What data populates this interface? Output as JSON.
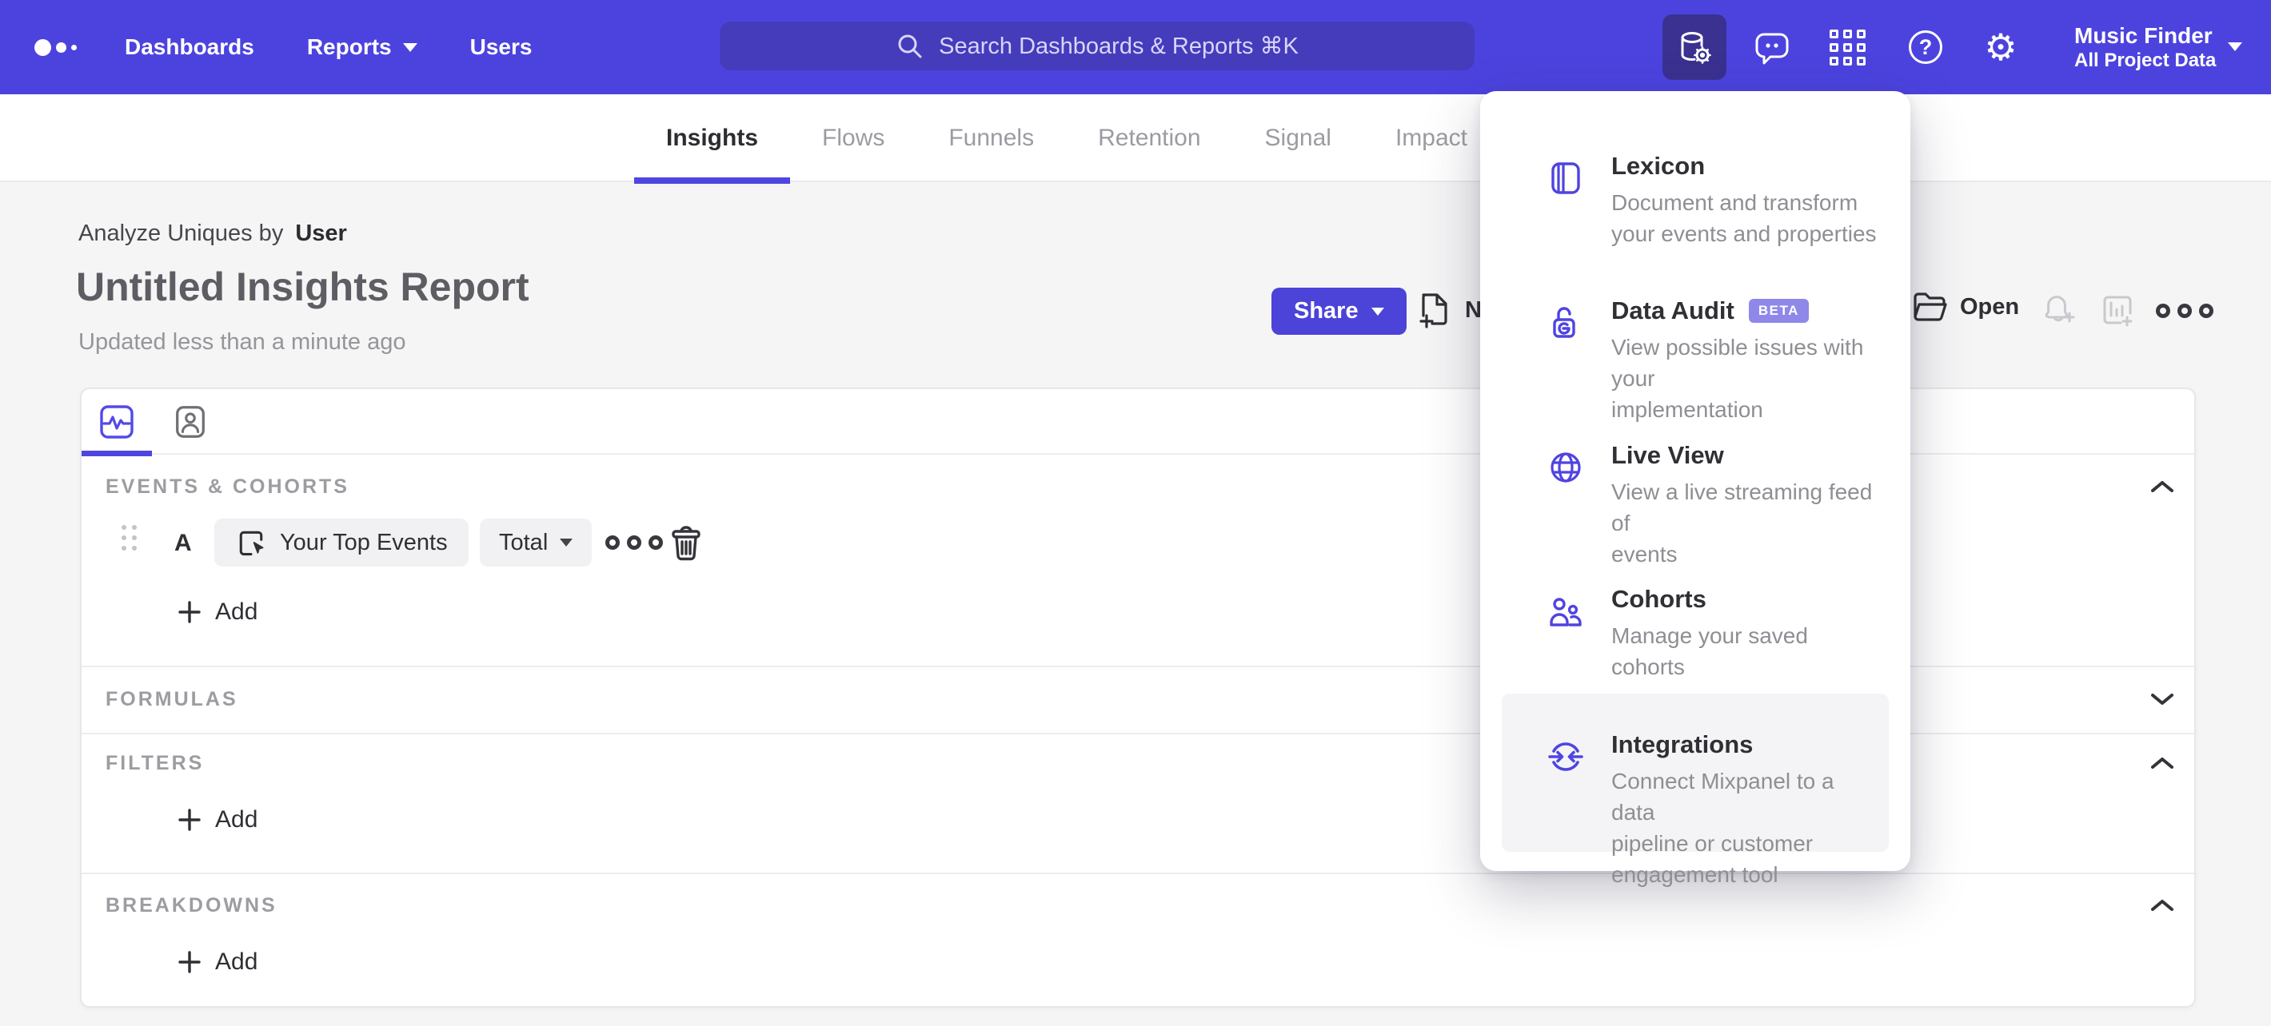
{
  "colors": {
    "accent": "#4c43df",
    "accent_active_tile": "#3a3190",
    "search_bg": "#453cbc",
    "share_button": "#4c43d9",
    "beta_badge": "#8f88e9",
    "page_bg": "#f5f5f6"
  },
  "header": {
    "nav": [
      {
        "label": "Dashboards"
      },
      {
        "label": "Reports"
      },
      {
        "label": "Users"
      }
    ],
    "search": {
      "placeholder": "Search Dashboards & Reports ⌘K"
    },
    "project": {
      "name": "Music Finder",
      "scope": "All Project Data"
    }
  },
  "tabs": [
    {
      "label": "Insights"
    },
    {
      "label": "Flows"
    },
    {
      "label": "Funnels"
    },
    {
      "label": "Retention"
    },
    {
      "label": "Signal"
    },
    {
      "label": "Impact"
    }
  ],
  "report": {
    "breadcrumb_prefix": "Analyze Uniques by",
    "breadcrumb_value": "User",
    "title": "Untitled Insights Report",
    "updated": "Updated less than a minute ago",
    "actions": {
      "share": "Share",
      "new": "New",
      "open": "Open"
    }
  },
  "builder": {
    "events": {
      "label": "EVENTS & COHORTS",
      "add_label": "Add",
      "row": {
        "letter": "A",
        "event": "Your Top Events",
        "metric": "Total"
      }
    },
    "formulas": {
      "label": "FORMULAS"
    },
    "filters": {
      "label": "FILTERS",
      "add_label": "Add"
    },
    "breakdowns": {
      "label": "BREAKDOWNS",
      "add_label": "Add"
    }
  },
  "menu": {
    "items": [
      {
        "title": "Lexicon",
        "desc": "Document and transform\nyour events and properties"
      },
      {
        "title": "Data Audit",
        "badge": "BETA",
        "desc": "View possible issues with your\nimplementation"
      },
      {
        "title": "Live View",
        "desc": "View a live streaming feed of\nevents"
      },
      {
        "title": "Cohorts",
        "desc": "Manage your saved cohorts"
      },
      {
        "title": "Integrations",
        "desc": "Connect Mixpanel to a data\npipeline or customer\nengagement tool"
      }
    ]
  }
}
